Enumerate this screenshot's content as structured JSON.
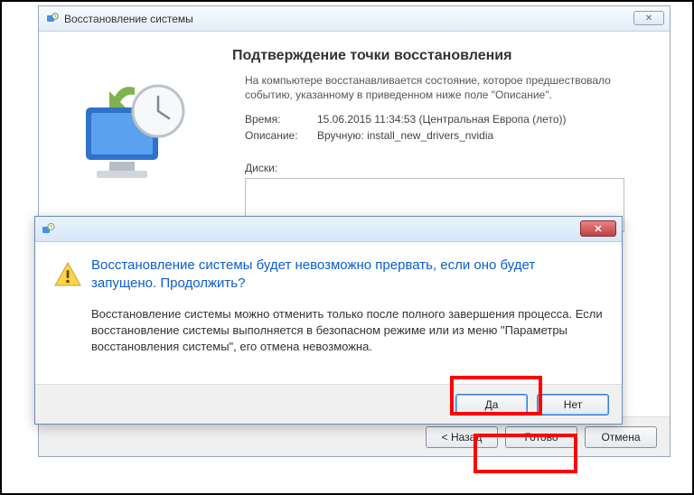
{
  "parent": {
    "title": "Восстановление системы",
    "close_glyph": "✕",
    "heading": "Подтверждение точки восстановления",
    "intro": "На компьютере восстанавливается состояние, которое предшествовало событию, указанному в приведенном ниже поле \"Описание\".",
    "time_label": "Время:",
    "time_value": "15.06.2015 11:34:53 (Центральная Европа (лето))",
    "desc_label": "Описание:",
    "desc_value": "Вручную: install_new_drivers_nvidia",
    "disks_label": "Диски:",
    "buttons": {
      "back": "< Назад",
      "ready": "Готово",
      "cancel": "Отмена"
    }
  },
  "modal": {
    "close_glyph": "✕",
    "heading": "Восстановление системы будет невозможно прервать, если оно будет запущено. Продолжить?",
    "body": "Восстановление системы можно отменить только после полного завершения процесса. Если восстановление системы выполняется в безопасном режиме или из меню \"Параметры восстановления системы\", его отмена невозможна.",
    "yes": "Да",
    "no": "Нет"
  }
}
